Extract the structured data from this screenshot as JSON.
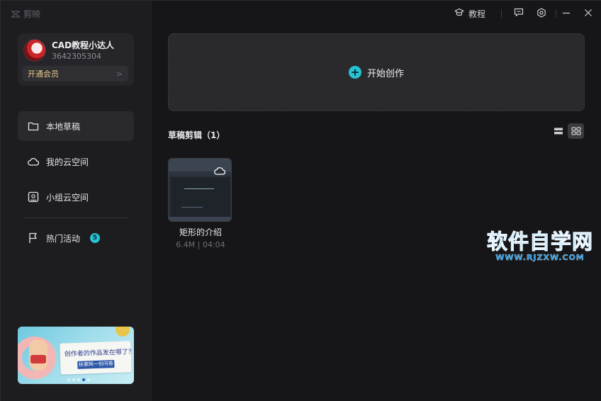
{
  "app": {
    "logo_text": "剪映"
  },
  "profile": {
    "username": "CAD教程小达人",
    "user_id": "3642305304",
    "vip_label": "开通会员",
    "vip_arrow": ">"
  },
  "nav": [
    {
      "label": "本地草稿",
      "icon": "folder-icon",
      "active": true
    },
    {
      "label": "我的云空间",
      "icon": "cloud-icon"
    },
    {
      "label": "小组云空间",
      "icon": "group-cloud-icon"
    },
    {
      "label": "热门活动",
      "icon": "flag-icon",
      "badge": "5"
    }
  ],
  "banner": {
    "title": "创作者的作品发在哪了？",
    "button": "扶意网一份问卷"
  },
  "topbar": {
    "tutorial_label": "教程"
  },
  "create": {
    "label": "开始创作"
  },
  "drafts": {
    "section_title": "草稿剪辑（1）",
    "items": [
      {
        "name": "矩形的介绍",
        "meta": "6.4M | 04:04"
      }
    ]
  },
  "watermark": {
    "title": "软件自学网",
    "url": "WWW.RJZXW.COM"
  },
  "colors": {
    "accent": "#27c2d3",
    "vip": "#e8c78a",
    "watermark": "#1f8fe0"
  }
}
